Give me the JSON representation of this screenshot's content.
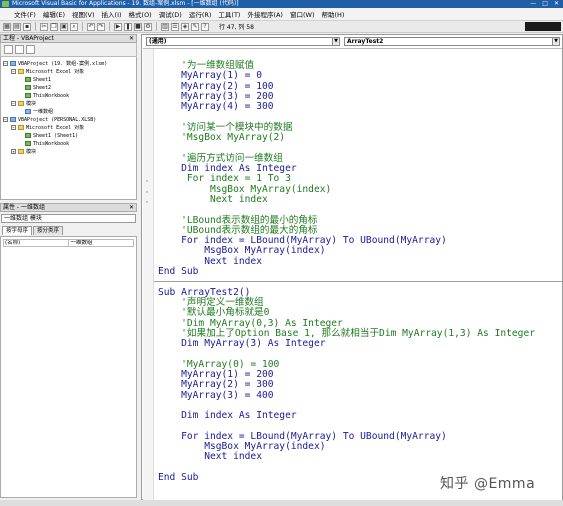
{
  "window": {
    "title": "Microsoft Visual Basic for Applications - 19. 数组-案例.xlsm - [一维数组 (代码)]",
    "buttons": [
      "—",
      "□",
      "✕"
    ]
  },
  "menu": [
    "文件(F)",
    "编辑(E)",
    "视图(V)",
    "插入(I)",
    "格式(O)",
    "调试(D)",
    "运行(R)",
    "工具(T)",
    "外接程序(A)",
    "窗口(W)",
    "帮助(H)"
  ],
  "toolbar": {
    "position": "行 47, 列 58"
  },
  "project": {
    "title": "工程 - VBAProject",
    "close": "✕",
    "tree": [
      {
        "label": "VBAProject (19. 数组-案例.xlsm)",
        "level": 0,
        "icon": "project-icon"
      },
      {
        "label": "Microsoft Excel 对象",
        "level": 1,
        "icon": "folder-icon"
      },
      {
        "label": "Sheet1",
        "level": 2,
        "icon": "sheet-icon"
      },
      {
        "label": "Sheet2",
        "level": 2,
        "icon": "sheet-icon"
      },
      {
        "label": "ThisWorkbook",
        "level": 2,
        "icon": "workbook-icon"
      },
      {
        "label": "模块",
        "level": 1,
        "icon": "folder-icon"
      },
      {
        "label": "一维数组",
        "level": 2,
        "icon": "module-icon"
      },
      {
        "label": "VBAProject (PERSONAL.XLSB)",
        "level": 0,
        "icon": "project-icon"
      },
      {
        "label": "Microsoft Excel 对象",
        "level": 1,
        "icon": "folder-icon"
      },
      {
        "label": "Sheet1 (Sheet1)",
        "level": 2,
        "icon": "sheet-icon"
      },
      {
        "label": "ThisWorkbook",
        "level": 2,
        "icon": "workbook-icon"
      },
      {
        "label": "模块",
        "level": 1,
        "icon": "folder-icon"
      }
    ]
  },
  "properties": {
    "title": "属性 - 一维数组",
    "close": "✕",
    "combo": "一维数组 模块",
    "tabs": [
      "按字母序",
      "按分类序"
    ],
    "row_key": "(名称)",
    "row_value": "一维数组"
  },
  "code": {
    "proc_combo": "(通用)",
    "sub_combo": "ArrayTest2",
    "lines": [
      {
        "t": "    '为一维数组赋值",
        "c": "cmt"
      },
      {
        "t": "    MyArray(1) = 0",
        "c": "kw"
      },
      {
        "t": "    MyArray(2) = 100",
        "c": "kw"
      },
      {
        "t": "    MyArray(3) = 200",
        "c": "kw"
      },
      {
        "t": "    MyArray(4) = 300",
        "c": "kw"
      },
      {
        "t": "",
        "c": "kw"
      },
      {
        "t": "    '访问某一个模块中的数据",
        "c": "cmt"
      },
      {
        "t": "    'MsgBox MyArray(2)",
        "c": "cmt"
      },
      {
        "t": "",
        "c": "kw"
      },
      {
        "t": "    '遍历方式访问一维数组",
        "c": "cmt"
      },
      {
        "t": "    Dim index As Integer",
        "c": "kw"
      },
      {
        "t": "     For index = 1 To 3",
        "c": "cmt"
      },
      {
        "t": "         MsgBox MyArray(index)",
        "c": "cmt"
      },
      {
        "t": "         Next index",
        "c": "cmt"
      },
      {
        "t": "",
        "c": "kw"
      },
      {
        "t": "    'LBound表示数组的最小的角标",
        "c": "cmt"
      },
      {
        "t": "    'UBound表示数组的最大的角标",
        "c": "cmt"
      },
      {
        "t": "    For index = LBound(MyArray) To UBound(MyArray)",
        "c": "kw"
      },
      {
        "t": "        MsgBox MyArray(index)",
        "c": "kw"
      },
      {
        "t": "        Next index",
        "c": "kw"
      },
      {
        "t": "End Sub",
        "c": "kw"
      },
      {
        "t": "",
        "c": "sep"
      },
      {
        "t": "Sub ArrayTest2()",
        "c": "kw"
      },
      {
        "t": "    '声明定义一维数组",
        "c": "cmt"
      },
      {
        "t": "    '默认最小角标就是0",
        "c": "cmt"
      },
      {
        "t": "    'Dim MyArray(0,3) As Integer",
        "c": "cmt"
      },
      {
        "t": "    '如果加上了Option Base 1, 那么就相当于Dim MyArray(1,3) As Integer",
        "c": "cmt"
      },
      {
        "t": "    Dim MyArray(3) As Integer",
        "c": "kw"
      },
      {
        "t": "",
        "c": "kw"
      },
      {
        "t": "    'MyArray(0) = 100",
        "c": "cmt"
      },
      {
        "t": "    MyArray(1) = 200",
        "c": "kw"
      },
      {
        "t": "    MyArray(2) = 300",
        "c": "kw"
      },
      {
        "t": "    MyArray(3) = 400",
        "c": "kw"
      },
      {
        "t": "",
        "c": "kw"
      },
      {
        "t": "    Dim index As Integer",
        "c": "kw"
      },
      {
        "t": "",
        "c": "kw"
      },
      {
        "t": "    For index = LBound(MyArray) To UBound(MyArray)",
        "c": "kw"
      },
      {
        "t": "        MsgBox MyArray(index)",
        "c": "kw"
      },
      {
        "t": "        Next index",
        "c": "kw"
      },
      {
        "t": "",
        "c": "kw"
      },
      {
        "t": "End Sub",
        "c": "kw"
      }
    ],
    "gutter_marks": [
      "'",
      "'",
      "'"
    ]
  },
  "watermark": "知乎 @Emma",
  "colors": {
    "title_bar": "#1f5fa8",
    "code_keyword": "#1a1a9a",
    "code_comment": "#1f7a1f"
  }
}
